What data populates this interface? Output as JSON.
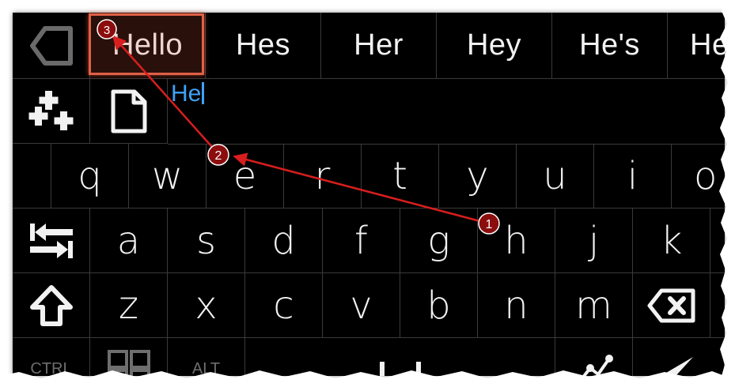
{
  "suggestions": [
    "Hello",
    "Hes",
    "Her",
    "Hey",
    "He's",
    "He"
  ],
  "editor": {
    "typed_text": "He"
  },
  "rows": {
    "row1": [
      "q",
      "w",
      "e",
      "r",
      "t",
      "y",
      "u",
      "i",
      "o"
    ],
    "row2": [
      "a",
      "s",
      "d",
      "f",
      "g",
      "h",
      "j",
      "k"
    ],
    "row3": [
      "z",
      "x",
      "c",
      "v",
      "b",
      "n",
      "m"
    ]
  },
  "modifiers": {
    "ctrl": "CTRL",
    "alt": "ALT"
  },
  "annotations": {
    "step1": "1",
    "step2": "2",
    "step3": "3"
  },
  "colors": {
    "accent_text": "#3fa2f7",
    "annotation_line": "#d81e1e",
    "annotation_badge": "#8b0d0d",
    "highlight": "#e06048"
  }
}
